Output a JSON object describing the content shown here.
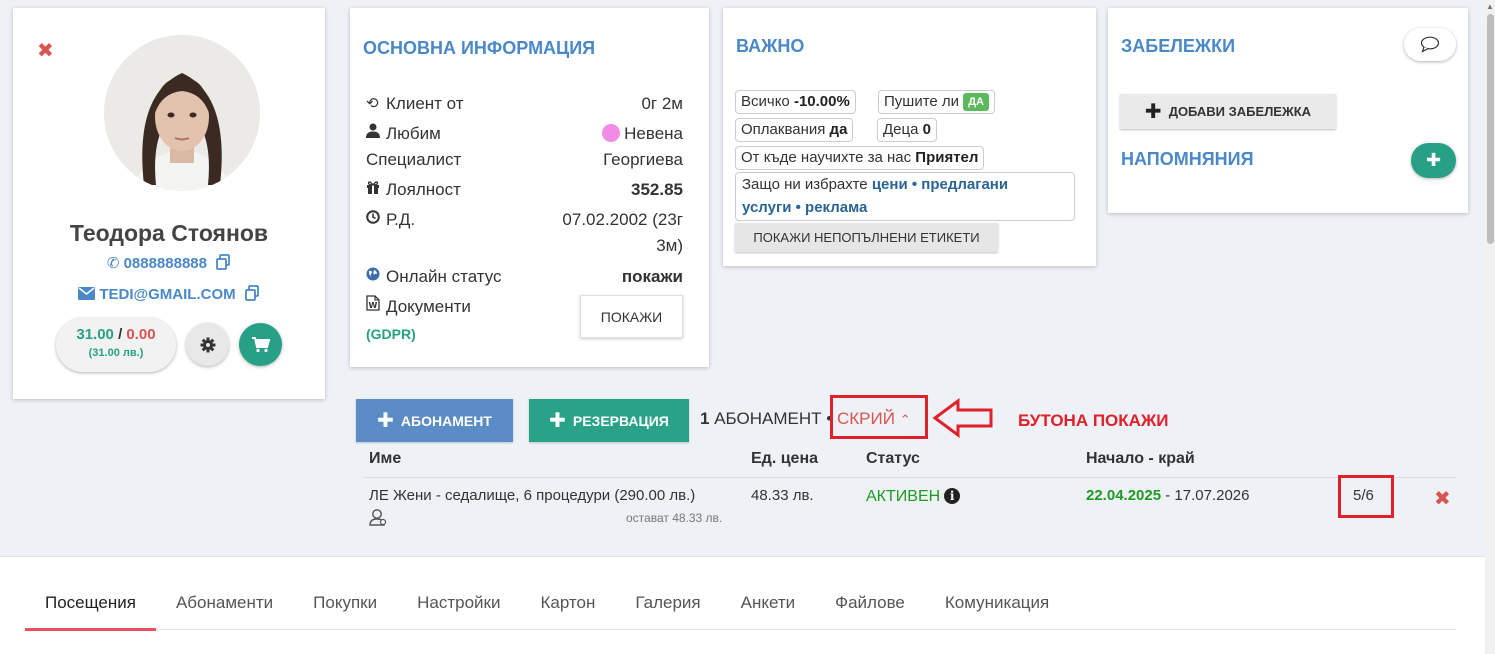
{
  "profile": {
    "name": "Теодора Стоянов",
    "phone": "0888888888",
    "email": "TEDI@GMAIL.COM",
    "balance_positive": "31.00",
    "balance_separator": " / ",
    "balance_negative": "0.00",
    "balance_sub": "(31.00 лв.)"
  },
  "basic_info": {
    "title": "ОСНОВНА ИНФОРМАЦИЯ",
    "client_since_label": "Клиент от",
    "client_since_value": "0г 2м",
    "favorite_label_1": "Любим",
    "favorite_label_2": "Специалист",
    "favorite_value_1": "Невена",
    "favorite_value_2": "Георгиева",
    "loyalty_label": "Лоялност",
    "loyalty_value": "352.85",
    "birthday_label": "Р.Д.",
    "birthday_value_1": "07.02.2002 (23г",
    "birthday_value_2": "3м)",
    "online_status_label": "Онлайн статус",
    "online_status_value": "покажи",
    "documents_label": "Документи",
    "gdpr_label": "(GDPR)",
    "documents_button": "ПОКАЖИ"
  },
  "important": {
    "title": "ВАЖНО",
    "total_label": "Всичко",
    "total_value": "-10.00%",
    "smoke_label": "Пушите ли",
    "smoke_value": "ДА",
    "complaints_label": "Оплаквания",
    "complaints_value": "да",
    "children_label": "Деца",
    "children_value": "0",
    "source_label": "От къде научихте за нас",
    "source_value": "Приятел",
    "reasons_label": "Защо ни избрахте",
    "reasons_value_1": "цени • предлагани",
    "reasons_value_2": "услуги • реклама",
    "show_tags_button": "ПОКАЖИ НЕПОПЪЛНЕНИ ЕТИКЕТИ"
  },
  "notes": {
    "title": "ЗАБЕЛЕЖКИ",
    "add_note_button": "ДОБАВИ ЗАБЕЛЕЖКА",
    "reminders_title": "НАПОМНЯНИЯ"
  },
  "actions": {
    "subscription_button": "АБОНАМЕНТ",
    "reservation_button": "РЕЗЕРВАЦИЯ",
    "count": "1",
    "count_label": " АБОНАМЕНТ •",
    "hide_link": "СКРИЙ",
    "annotation": "БУТОНА ПОКАЖИ"
  },
  "table": {
    "headers": [
      "Име",
      "Ед. цена",
      "Статус",
      "Начало - край"
    ],
    "row": {
      "name": "ЛЕ Жени - седалище, 6 процедури (290.00 лв.)",
      "remaining": "остават 48.33 лв.",
      "price": "48.33 лв.",
      "status": "АКТИВЕН",
      "start": "22.04.2025",
      "end_sep": " - ",
      "end": "17.07.2026",
      "visits": "5/6"
    }
  },
  "tabs": [
    "Посещения",
    "Абонаменти",
    "Покупки",
    "Настройки",
    "Картон",
    "Галерия",
    "Анкети",
    "Файлове",
    "Комуникация"
  ],
  "colors": {
    "accent_blue": "#4a88c8",
    "accent_green": "#27a085",
    "danger_red": "#d9534f",
    "annotation_red": "#e0202b"
  }
}
